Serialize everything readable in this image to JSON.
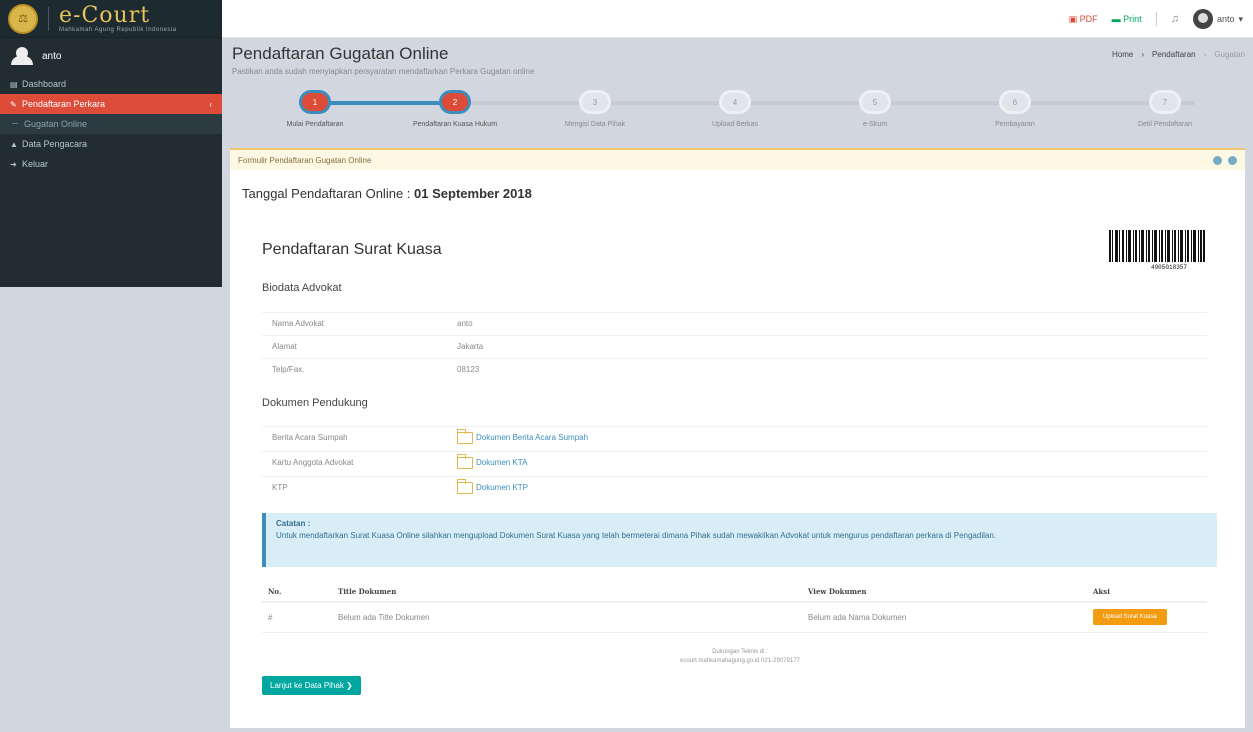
{
  "app": {
    "logo_text": "e-Court",
    "logo_sub": "Mahkamah Agung Republik Indonesia",
    "user_name": "anto"
  },
  "sidebar": {
    "items": [
      {
        "label": "Dashboard",
        "icon": "dashboard-icon"
      },
      {
        "label": "Pendaftaran Perkara",
        "icon": "edit-icon",
        "active": true
      },
      {
        "label": "Gugatan Online",
        "icon": "circle-icon",
        "sub": true
      },
      {
        "label": "Data Pengacara",
        "icon": "user-icon"
      },
      {
        "label": "Keluar",
        "icon": "logout-icon"
      }
    ]
  },
  "topbar": {
    "pdf_label": "PDF",
    "print_label": "Print",
    "user_label": "anto"
  },
  "header": {
    "title": "Pendaftaran Gugatan Online",
    "subtitle": "Pastikan anda sudah menyiapkan persyaratan mendaftarkan Perkara Gugatan online",
    "breadcrumb": [
      "Home",
      "Pendaftaran",
      "Gugatan"
    ]
  },
  "stepper": {
    "steps": [
      {
        "num": "1",
        "label": "Mulai Pendaftaran",
        "done": true
      },
      {
        "num": "2",
        "label": "Pendaftaran Kuasa Hukum",
        "done": true
      },
      {
        "num": "3",
        "label": "Mengisi Data Pihak",
        "done": false
      },
      {
        "num": "4",
        "label": "Upload Berkas",
        "done": false
      },
      {
        "num": "5",
        "label": "e-Skum",
        "done": false
      },
      {
        "num": "6",
        "label": "Pembayaran",
        "done": false
      },
      {
        "num": "7",
        "label": "Detil Pendaftaran",
        "done": false
      }
    ]
  },
  "box": {
    "title": "Formulir Pendaftaran Gugatan Online",
    "tanggal_label": "Tanggal Pendaftaran Online :",
    "tanggal_value": "01 September 2018",
    "section_title": "Pendaftaran Surat Kuasa",
    "barcode_number": "4905018357",
    "biodata_title": "Biodata Advokat",
    "biodata": [
      {
        "key": "Nama Advokat",
        "value": "anto"
      },
      {
        "key": "Alamat",
        "value": "Jakarta"
      },
      {
        "key": "Telp/Fax.",
        "value": "08123"
      }
    ],
    "dokumen_title": "Dokumen Pendukung",
    "dokumen": [
      {
        "key": "Berita Acara Sumpah",
        "value": "Dokumen Berita Acara Sumpah"
      },
      {
        "key": "Kartu Anggota Advokat",
        "value": "Dokumen KTA"
      },
      {
        "key": "KTP",
        "value": "Dokumen KTP"
      }
    ],
    "catatan_title": "Catatan :",
    "catatan_body": "Untuk mendaftarkan Surat Kuasa Online silahkan mengupload Dokumen Surat Kuasa yang telah bermeterai dimana Pihak sudah mewakilkan Advokat untuk mengurus pendaftaran perkara di Pengadilan.",
    "table": {
      "headers": [
        "No.",
        "Title Dokumen",
        "View Dokumen",
        "Aksi"
      ],
      "row": {
        "no": "#",
        "title": "Belum ada Title Dokumen",
        "view": "Belum ada Nama Dokumen",
        "aksi": "Upload Surat Kuasa"
      }
    },
    "footer_line1": "Dukungan Teknis di :",
    "footer_line2": "ecourt.mahkamahagung.go.id   021-29079177",
    "next_button": "Lanjut ke Data Pihak ❯"
  }
}
